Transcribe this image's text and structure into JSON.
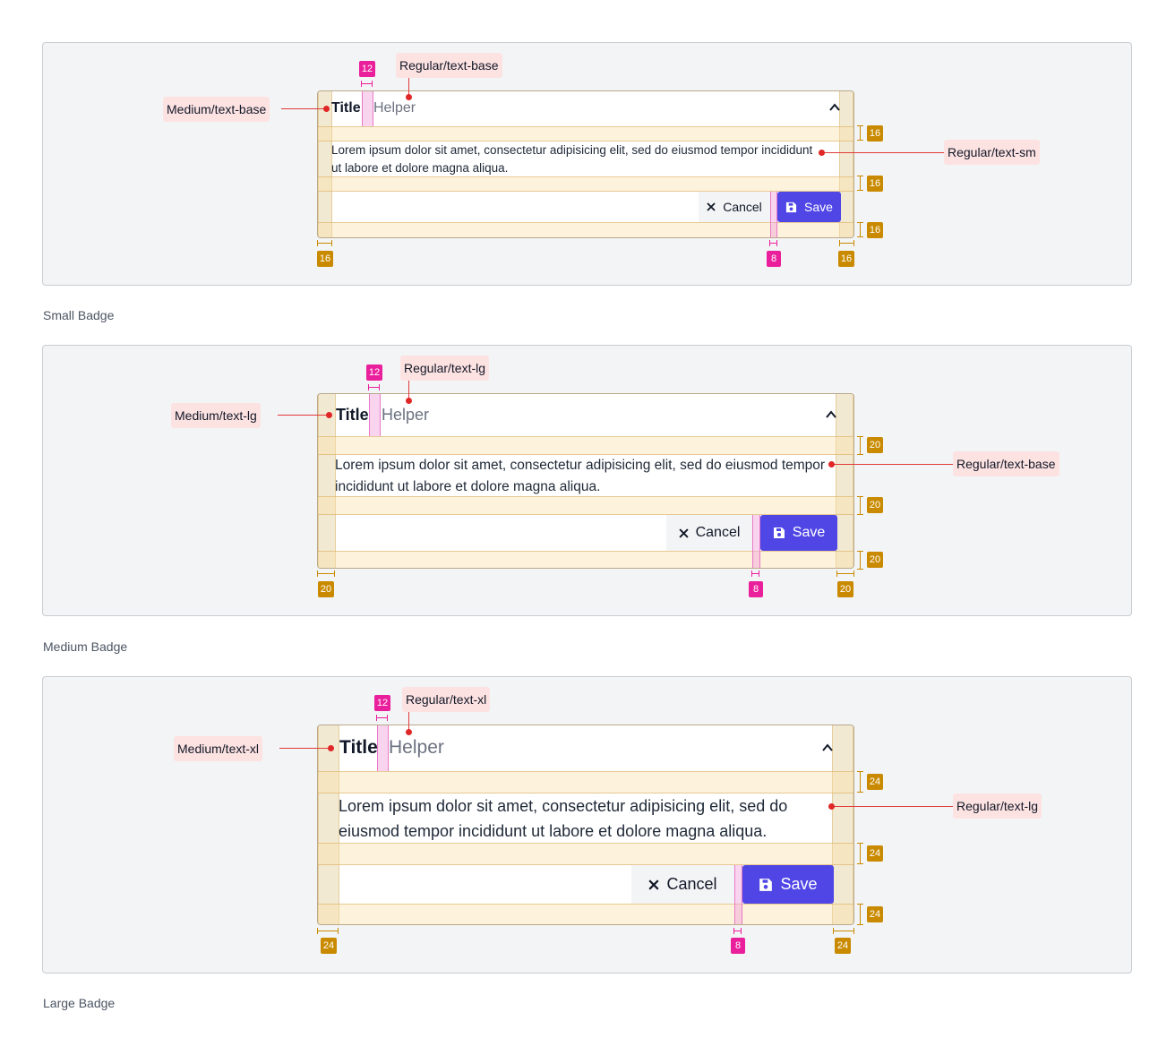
{
  "sections": [
    {
      "caption": "Small Badge",
      "title": "Title",
      "helper": "Helper",
      "body": "Lorem ipsum dolor sit amet, consectetur adipisicing elit, sed do eiusmod tempor incididunt ut labore et dolore magna aliqua.",
      "cancel": "Cancel",
      "save": "Save",
      "title_style": "Medium/text-base",
      "helper_style": "Regular/text-base",
      "body_style": "Regular/text-sm",
      "gap_title_helper": "12",
      "gap_buttons": "8",
      "pad_v1": "16",
      "pad_v2": "16",
      "pad_v3": "16",
      "pad_left": "16",
      "pad_right": "16"
    },
    {
      "caption": "Medium Badge",
      "title": "Title",
      "helper": "Helper",
      "body": "Lorem ipsum dolor sit amet, consectetur adipisicing elit, sed do eiusmod tempor incididunt ut labore et dolore magna aliqua.",
      "cancel": "Cancel",
      "save": "Save",
      "title_style": "Medium/text-lg",
      "helper_style": "Regular/text-lg",
      "body_style": "Regular/text-base",
      "gap_title_helper": "12",
      "gap_buttons": "8",
      "pad_v1": "20",
      "pad_v2": "20",
      "pad_v3": "20",
      "pad_left": "20",
      "pad_right": "20"
    },
    {
      "caption": "Large Badge",
      "title": "Title",
      "helper": "Helper",
      "body": "Lorem ipsum dolor sit amet, consectetur adipisicing elit, sed do eiusmod tempor incididunt ut labore et dolore magna aliqua.",
      "cancel": "Cancel",
      "save": "Save",
      "title_style": "Medium/text-xl",
      "helper_style": "Regular/text-xl",
      "body_style": "Regular/text-lg",
      "gap_title_helper": "12",
      "gap_buttons": "8",
      "pad_v1": "24",
      "pad_v2": "24",
      "pad_v3": "24",
      "pad_left": "24",
      "pad_right": "24"
    }
  ],
  "icons": {
    "chevron": "chevron-up-icon",
    "cancel": "close-icon",
    "save": "floppy-disk-icon"
  },
  "colors": {
    "save_bg": "#4f46e5",
    "padding_highlight": "#fae1aa",
    "gap_highlight": "#f0a0dc",
    "size_badge_gold": "#c98a00",
    "size_badge_pink": "#ea1f9b",
    "annotation_chip": "#fde2e2",
    "annotation_line": "#e23a3a"
  }
}
